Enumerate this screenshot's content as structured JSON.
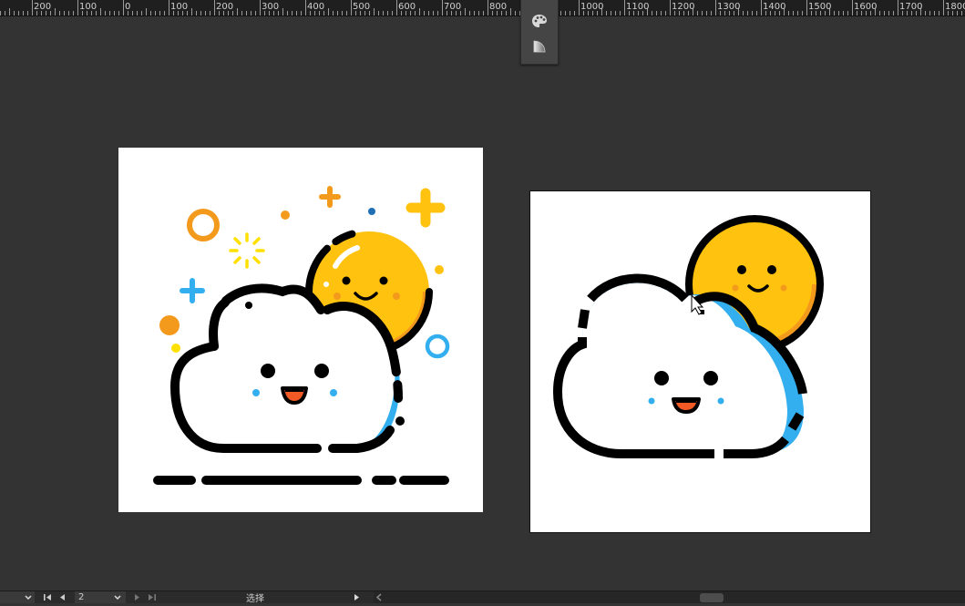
{
  "ruler": {
    "labels": [
      "200",
      "100",
      "0",
      "100",
      "200",
      "300",
      "400",
      "500",
      "600",
      "700",
      "800",
      "1000",
      "1100",
      "1200",
      "1300",
      "1400",
      "1500",
      "1600",
      "1700",
      "1800"
    ]
  },
  "toolbar": {
    "tools": [
      {
        "name": "palette-icon"
      },
      {
        "name": "gradient-icon"
      }
    ]
  },
  "statusbar": {
    "page_number": "2",
    "tool_label": "选择"
  },
  "colors": {
    "workspace": "#333333",
    "sun": "#FFC20E",
    "orange": "#F39A1D",
    "blue": "#33AEEF",
    "outline": "#000000",
    "mouth": "#F15A24"
  }
}
